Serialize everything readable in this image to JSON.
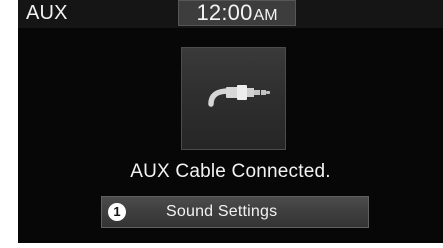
{
  "header": {
    "source": "AUX",
    "clock": {
      "time": "12:00",
      "period": "AM"
    }
  },
  "main": {
    "icon": "aux-cable-icon",
    "status": "AUX Cable Connected.",
    "sound_settings": {
      "badge": "1",
      "label": "Sound Settings"
    }
  }
}
